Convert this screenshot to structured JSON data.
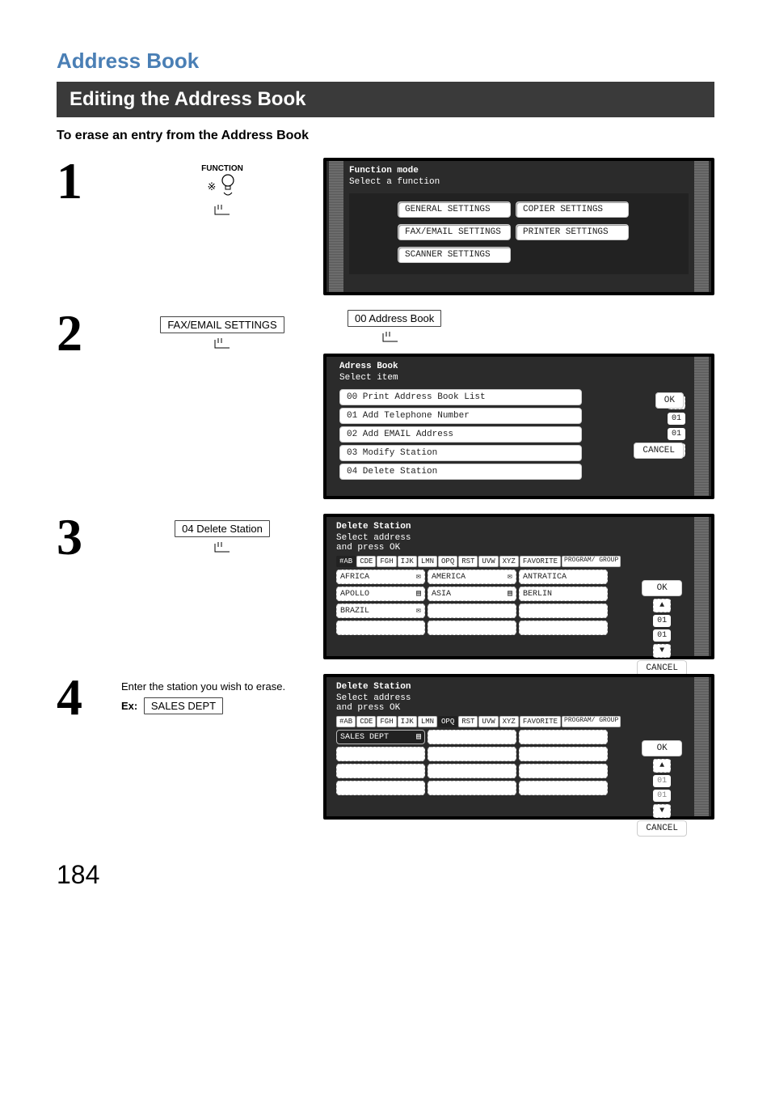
{
  "page": {
    "section": "Address Book",
    "bar": "Editing the Address Book",
    "subhead": "To erase an entry from the Address Book",
    "page_number": "184"
  },
  "step1": {
    "func_caption": "FUNCTION",
    "func_icon_label": "※",
    "panel_title": "Function mode",
    "panel_sub": "Select a function",
    "buttons": {
      "general": "GENERAL SETTINGS",
      "copier": "COPIER SETTINGS",
      "faxemail": "FAX/EMAIL SETTINGS",
      "printer": "PRINTER SETTINGS",
      "scanner": "SCANNER SETTINGS"
    }
  },
  "step2": {
    "left_btn": "FAX/EMAIL SETTINGS",
    "right_btn": "00 Address Book",
    "panel_title": "Adress Book",
    "panel_sub": "Select item",
    "items": {
      "i0": "00  Print Address Book List",
      "i1": "01  Add Telephone Number",
      "i2": "02  Add EMAIL Address",
      "i3": "03  Modify Station",
      "i4": "04  Delete Station"
    },
    "side": {
      "up": "▲",
      "v1": "01",
      "v2": "01",
      "down": "▼",
      "ok": "OK",
      "cancel": "CANCEL"
    }
  },
  "step3": {
    "left_btn": "04 Delete Station",
    "panel_title": "Delete Station",
    "panel_sub1": "Select address",
    "panel_sub2": "and press OK",
    "tabs": {
      "t1": "#AB",
      "t2": "CDE",
      "t3": "FGH",
      "t4": "IJK",
      "t5": "LMN",
      "t6": "OPQ",
      "t7": "RST",
      "t8": "UVW",
      "t9": "XYZ",
      "fav": "FAVORITE",
      "grp": "PROGRAM/\nGROUP"
    },
    "cells": {
      "c1": "AFRICA",
      "c2": "AMERICA",
      "c3": "ANTRATICA",
      "c4": "APOLLO",
      "c5": "ASIA",
      "c6": "BERLIN",
      "c7": "BRAZIL"
    },
    "icons": {
      "mail": "✉",
      "doc": "▤"
    },
    "side": {
      "up": "▲",
      "v1": "01",
      "v2": "01",
      "down": "▼",
      "ok": "OK",
      "cancel": "CANCEL"
    }
  },
  "step4": {
    "instr": "Enter the station you wish to erase.",
    "ex_label": "Ex:",
    "ex_value": "SALES DEPT",
    "panel_title": "Delete Station",
    "panel_sub1": "Select address",
    "panel_sub2": "and press OK",
    "tabs": {
      "t1": "#AB",
      "t2": "CDE",
      "t3": "FGH",
      "t4": "IJK",
      "t5": "LMN",
      "t6": "OPQ",
      "t7": "RST",
      "t8": "UVW",
      "t9": "XYZ",
      "fav": "FAVORITE",
      "grp": "PROGRAM/\nGROUP"
    },
    "selected": "SALES DEPT",
    "icons": {
      "doc": "▤"
    },
    "side": {
      "up": "▲",
      "v1": "01",
      "v2": "01",
      "down": "▼",
      "ok": "OK",
      "cancel": "CANCEL"
    }
  }
}
